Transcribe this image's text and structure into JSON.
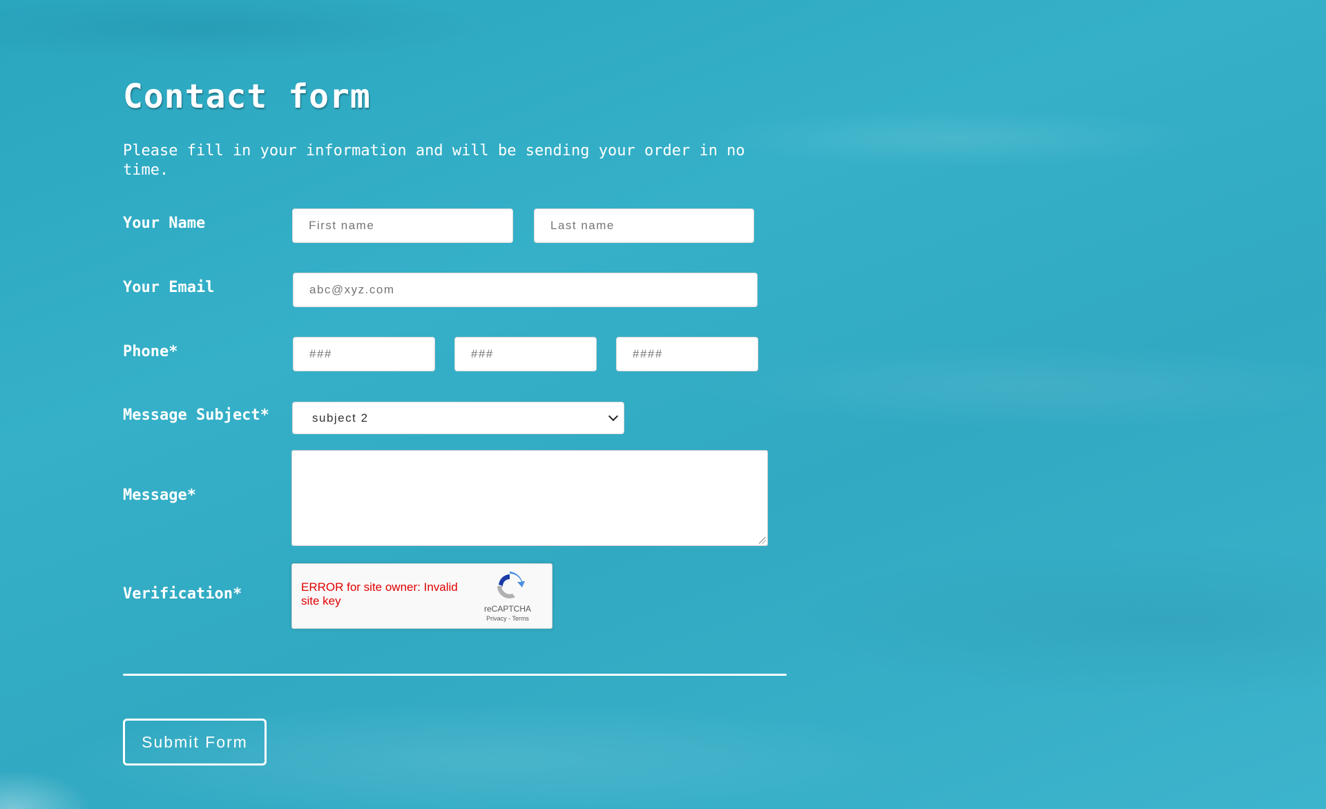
{
  "form": {
    "title": "Contact form",
    "intro": "Please fill in your information and will be sending your order in no time."
  },
  "name": {
    "label": "Your Name",
    "first_placeholder": "First name",
    "last_placeholder": "Last name"
  },
  "email": {
    "label": "Your Email",
    "placeholder": "abc@xyz.com"
  },
  "phone": {
    "label": "Phone*",
    "area_placeholder": "###",
    "prefix_placeholder": "###",
    "line_placeholder": "####"
  },
  "subject": {
    "label": "Message Subject*",
    "selected": "subject 2"
  },
  "message": {
    "label": "Message*"
  },
  "verification": {
    "label": "Verification*",
    "error_text": "ERROR for site owner: Invalid site key",
    "brand": "reCAPTCHA",
    "links": "Privacy - Terms"
  },
  "submit": {
    "label": "Submit Form"
  },
  "colors": {
    "background": "#31a9c2",
    "text": "#ffffff",
    "error": "#e10000"
  }
}
